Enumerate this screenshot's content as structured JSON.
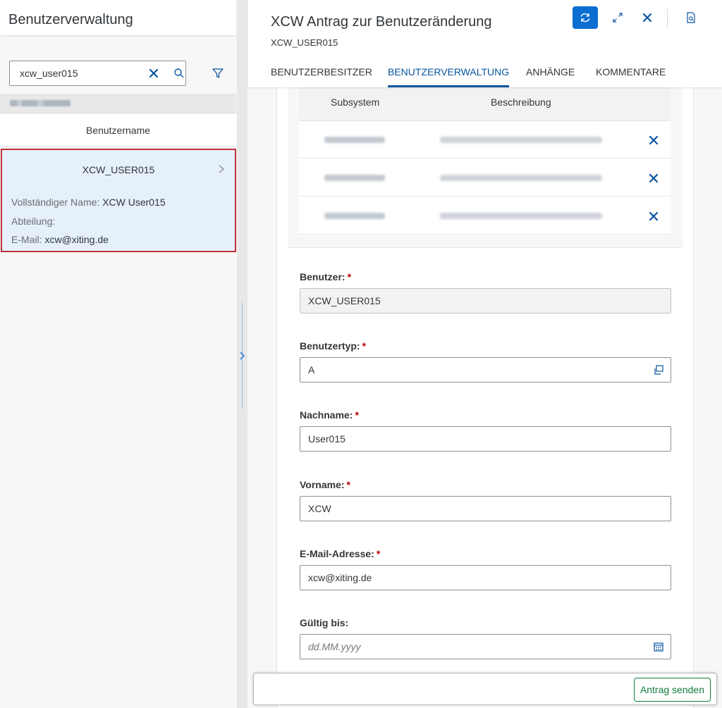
{
  "left_pane": {
    "title": "Benutzerverwaltung",
    "search": {
      "value": "xcw_user015"
    },
    "column_header": "Benutzername",
    "selected_item": {
      "title": "XCW_USER015",
      "full_name_label": "Vollständiger Name:",
      "full_name": "XCW User015",
      "department_label": "Abteilung:",
      "department": "",
      "email_label": "E-Mail:",
      "email": "xcw@xiting.de"
    }
  },
  "detail": {
    "title": "XCW Antrag zur Benutzeränderung",
    "subtitle": "XCW_USER015",
    "tabs": [
      {
        "label": "BENUTZERBESITZER"
      },
      {
        "label": "BENUTZERVERWALTUNG"
      },
      {
        "label": "ANHÄNGE"
      },
      {
        "label": "KOMMENTARE"
      }
    ],
    "subsystem_table": {
      "columns": [
        "Subsystem",
        "Beschreibung"
      ]
    },
    "form": {
      "user_label": "Benutzer:",
      "user_value": "XCW_USER015",
      "usertype_label": "Benutzertyp:",
      "usertype_value": "A",
      "lastname_label": "Nachname:",
      "lastname_value": "User015",
      "firstname_label": "Vorname:",
      "firstname_value": "XCW",
      "email_label": "E-Mail-Adresse:",
      "email_value": "xcw@xiting.de",
      "valid_label": "Gültig bis:",
      "valid_placeholder": "dd.MM.yyyy",
      "required_mark": "*"
    },
    "submit_label": "Antrag senden"
  },
  "colors": {
    "brand": "#0a6ed1",
    "active_tab": "#0854a0",
    "selection_bg": "#e5f0fa",
    "selection_border": "#c0303a",
    "accept": "#107e3e"
  }
}
